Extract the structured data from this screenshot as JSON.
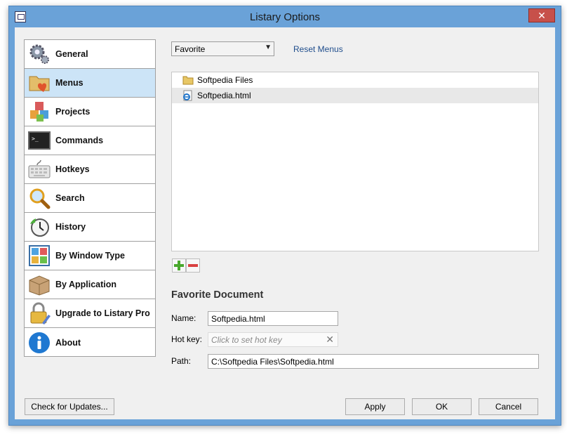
{
  "window": {
    "title": "Listary Options",
    "close_label": "✕"
  },
  "sidebar": {
    "items": [
      {
        "label": "General",
        "icon": "gear-icon"
      },
      {
        "label": "Menus",
        "icon": "folder-heart-icon",
        "active": true
      },
      {
        "label": "Projects",
        "icon": "cubes-icon"
      },
      {
        "label": "Commands",
        "icon": "terminal-icon"
      },
      {
        "label": "Hotkeys",
        "icon": "keyboard-icon"
      },
      {
        "label": "Search",
        "icon": "magnifier-icon"
      },
      {
        "label": "History",
        "icon": "clock-icon"
      },
      {
        "label": "By Window Type",
        "icon": "window-grid-icon"
      },
      {
        "label": "By Application",
        "icon": "package-icon"
      },
      {
        "label": "Upgrade to Listary Pro",
        "icon": "lock-icon"
      },
      {
        "label": "About",
        "icon": "info-icon"
      }
    ]
  },
  "menu_selector": {
    "value": "Favorite",
    "arrow": "▼"
  },
  "reset_menus_label": "Reset Menus",
  "favorites": [
    {
      "name": "Softpedia Files",
      "icon": "folder-icon"
    },
    {
      "name": "Softpedia.html",
      "icon": "html-file-icon",
      "selected": true
    }
  ],
  "toolbar": {
    "add_icon": "plus-icon",
    "remove_icon": "minus-icon"
  },
  "detail": {
    "title": "Favorite Document",
    "name_label": "Name:",
    "name_value": "Softpedia.html",
    "hotkey_label": "Hot key:",
    "hotkey_placeholder": "Click to set hot key",
    "hotkey_clear": "✕",
    "path_label": "Path:",
    "path_value": "C:\\Softpedia Files\\Softpedia.html"
  },
  "buttons": {
    "check_updates": "Check for Updates...",
    "apply": "Apply",
    "ok": "OK",
    "cancel": "Cancel"
  },
  "colors": {
    "frame": "#6aa2d8",
    "close": "#c7504a",
    "active_item": "#cce4f7",
    "link": "#1f4d8c"
  }
}
